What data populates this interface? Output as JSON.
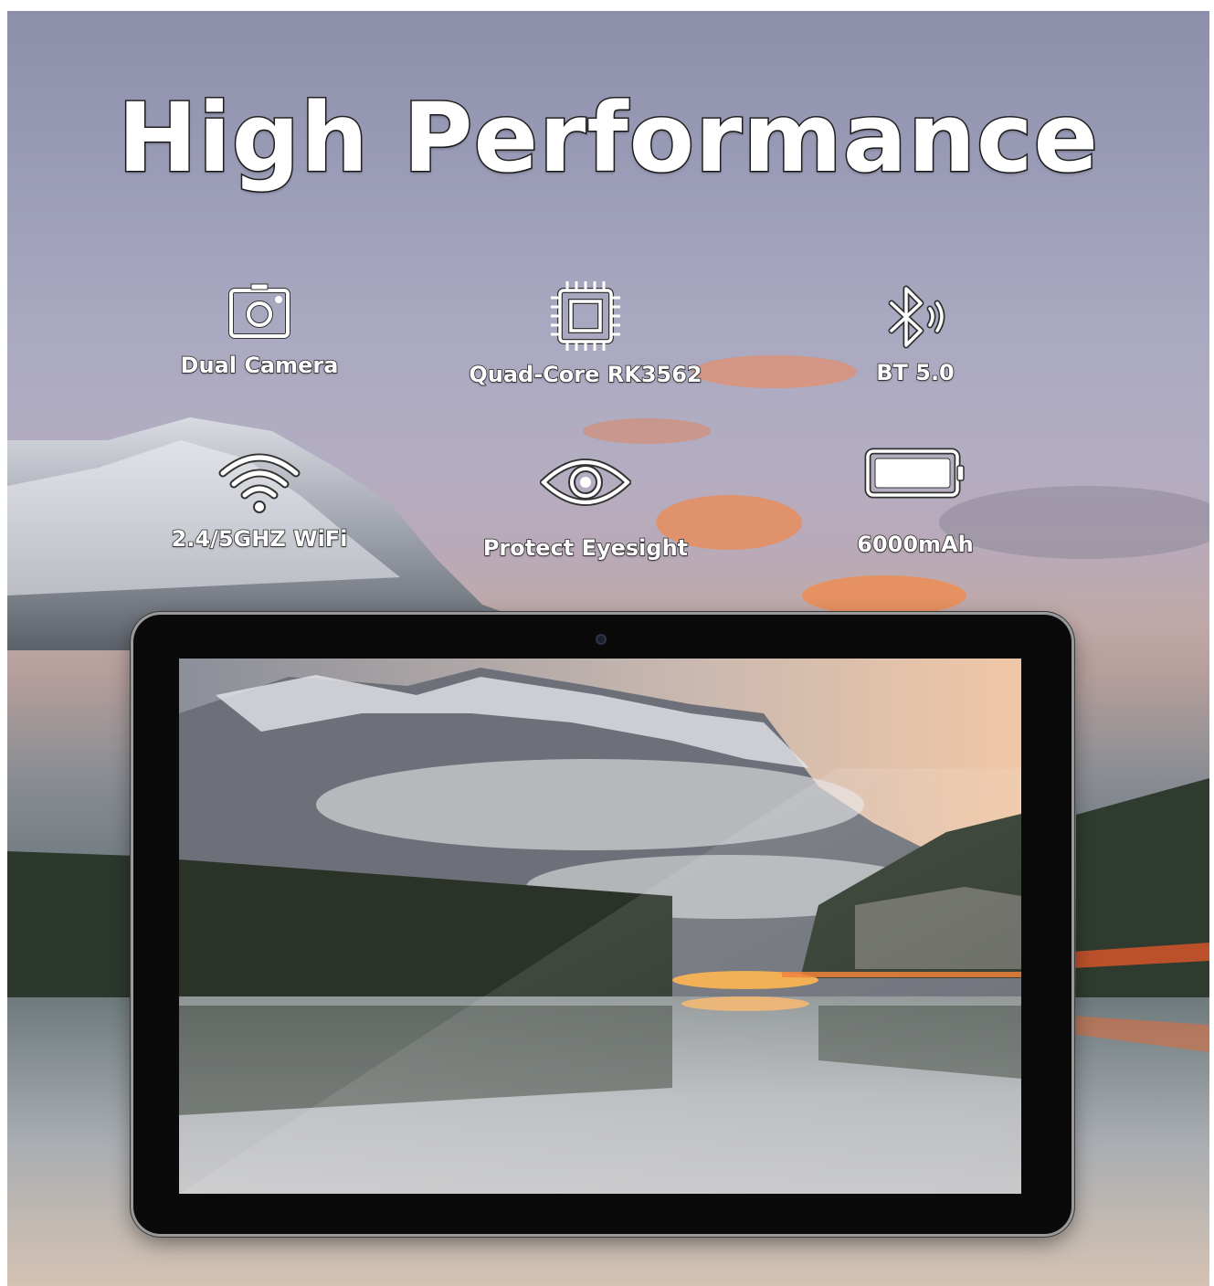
{
  "headline": "High Performance",
  "features": [
    {
      "icon": "camera-icon",
      "label": "Dual Camera"
    },
    {
      "icon": "cpu-chip-icon",
      "label": "Quad-Core RK3562"
    },
    {
      "icon": "bluetooth-icon",
      "label": "BT 5.0"
    },
    {
      "icon": "wifi-icon",
      "label": "2.4/5GHZ WiFi"
    },
    {
      "icon": "eye-icon",
      "label": "Protect Eyesight"
    },
    {
      "icon": "battery-icon",
      "label": "6000mAh"
    }
  ],
  "colors": {
    "text": "#ffffff",
    "outline": "#222222",
    "bezel": "#0a0a0a",
    "sunset_orange": "#f28a4a"
  }
}
